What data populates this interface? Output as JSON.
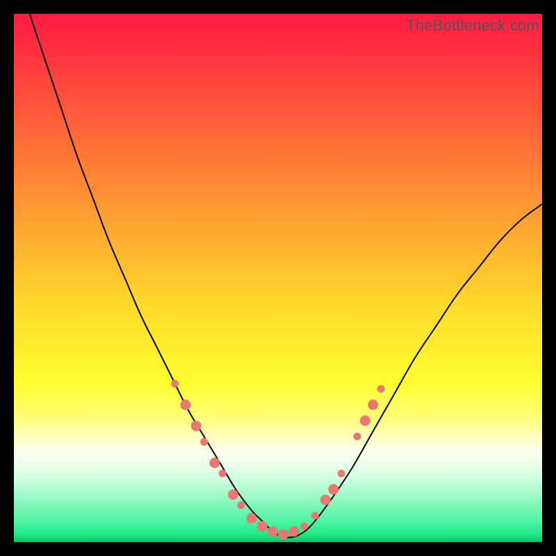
{
  "watermark": "TheBottleneck.com",
  "colors": {
    "frame": "#000000",
    "curve": "#000000",
    "bead_fill": "#e97774",
    "bead_stroke": "#e97774"
  },
  "gradient_stops": [
    {
      "offset": 0.0,
      "color": "#ff1b44"
    },
    {
      "offset": 0.1,
      "color": "#ff3b3e"
    },
    {
      "offset": 0.25,
      "color": "#ff7037"
    },
    {
      "offset": 0.4,
      "color": "#ffa531"
    },
    {
      "offset": 0.55,
      "color": "#ffd92b"
    },
    {
      "offset": 0.7,
      "color": "#ffff2f"
    },
    {
      "offset": 0.77,
      "color": "#ffff80"
    },
    {
      "offset": 0.8,
      "color": "#ffffc0"
    },
    {
      "offset": 0.83,
      "color": "#fafff0"
    },
    {
      "offset": 0.88,
      "color": "#d0ffe0"
    },
    {
      "offset": 0.92,
      "color": "#90f9c0"
    },
    {
      "offset": 0.96,
      "color": "#50f3a0"
    },
    {
      "offset": 0.985,
      "color": "#20eb87"
    },
    {
      "offset": 1.0,
      "color": "#06c465"
    }
  ],
  "chart_data": {
    "type": "line",
    "title": "",
    "xlabel": "",
    "ylabel": "",
    "xlim": [
      0,
      100
    ],
    "ylim": [
      0,
      100
    ],
    "note": "V-shaped bottleneck curve. y≈0 is optimal (green), y≈100 is worst (red). Values read from pixel positions.",
    "series": [
      {
        "name": "bottleneck-curve",
        "x": [
          0,
          3,
          6,
          9,
          12,
          15,
          18,
          21,
          24,
          27,
          30,
          33,
          36,
          39,
          42,
          45,
          47,
          49,
          51,
          53,
          55,
          57,
          60,
          64,
          68,
          72,
          76,
          80,
          84,
          88,
          92,
          96,
          100
        ],
        "y": [
          110,
          100,
          91,
          82,
          73,
          65,
          57,
          50,
          43,
          37,
          31,
          25,
          20,
          15,
          10,
          6,
          4,
          2,
          1,
          1,
          2,
          4,
          8,
          14,
          21,
          28,
          35,
          41,
          47,
          52,
          57,
          61,
          64
        ]
      }
    ],
    "beads": [
      {
        "x": 30.5,
        "y": 30,
        "r": 5
      },
      {
        "x": 32.5,
        "y": 26,
        "r": 7
      },
      {
        "x": 34.5,
        "y": 22,
        "r": 7
      },
      {
        "x": 36.0,
        "y": 19,
        "r": 5
      },
      {
        "x": 38.0,
        "y": 15,
        "r": 7
      },
      {
        "x": 39.5,
        "y": 13,
        "r": 5
      },
      {
        "x": 41.5,
        "y": 9,
        "r": 7
      },
      {
        "x": 43.0,
        "y": 7,
        "r": 5
      },
      {
        "x": 45.0,
        "y": 4.5,
        "r": 7
      },
      {
        "x": 47.0,
        "y": 3,
        "r": 7
      },
      {
        "x": 49.0,
        "y": 2,
        "r": 7
      },
      {
        "x": 51.0,
        "y": 1.5,
        "r": 7
      },
      {
        "x": 53.0,
        "y": 2,
        "r": 7
      },
      {
        "x": 55.0,
        "y": 3,
        "r": 5
      },
      {
        "x": 57.0,
        "y": 5,
        "r": 5
      },
      {
        "x": 59.0,
        "y": 8,
        "r": 7
      },
      {
        "x": 60.5,
        "y": 10,
        "r": 7
      },
      {
        "x": 62.0,
        "y": 13,
        "r": 5
      },
      {
        "x": 65.0,
        "y": 20,
        "r": 5
      },
      {
        "x": 66.5,
        "y": 23,
        "r": 7
      },
      {
        "x": 68.0,
        "y": 26,
        "r": 7
      },
      {
        "x": 69.5,
        "y": 29,
        "r": 5
      }
    ]
  }
}
